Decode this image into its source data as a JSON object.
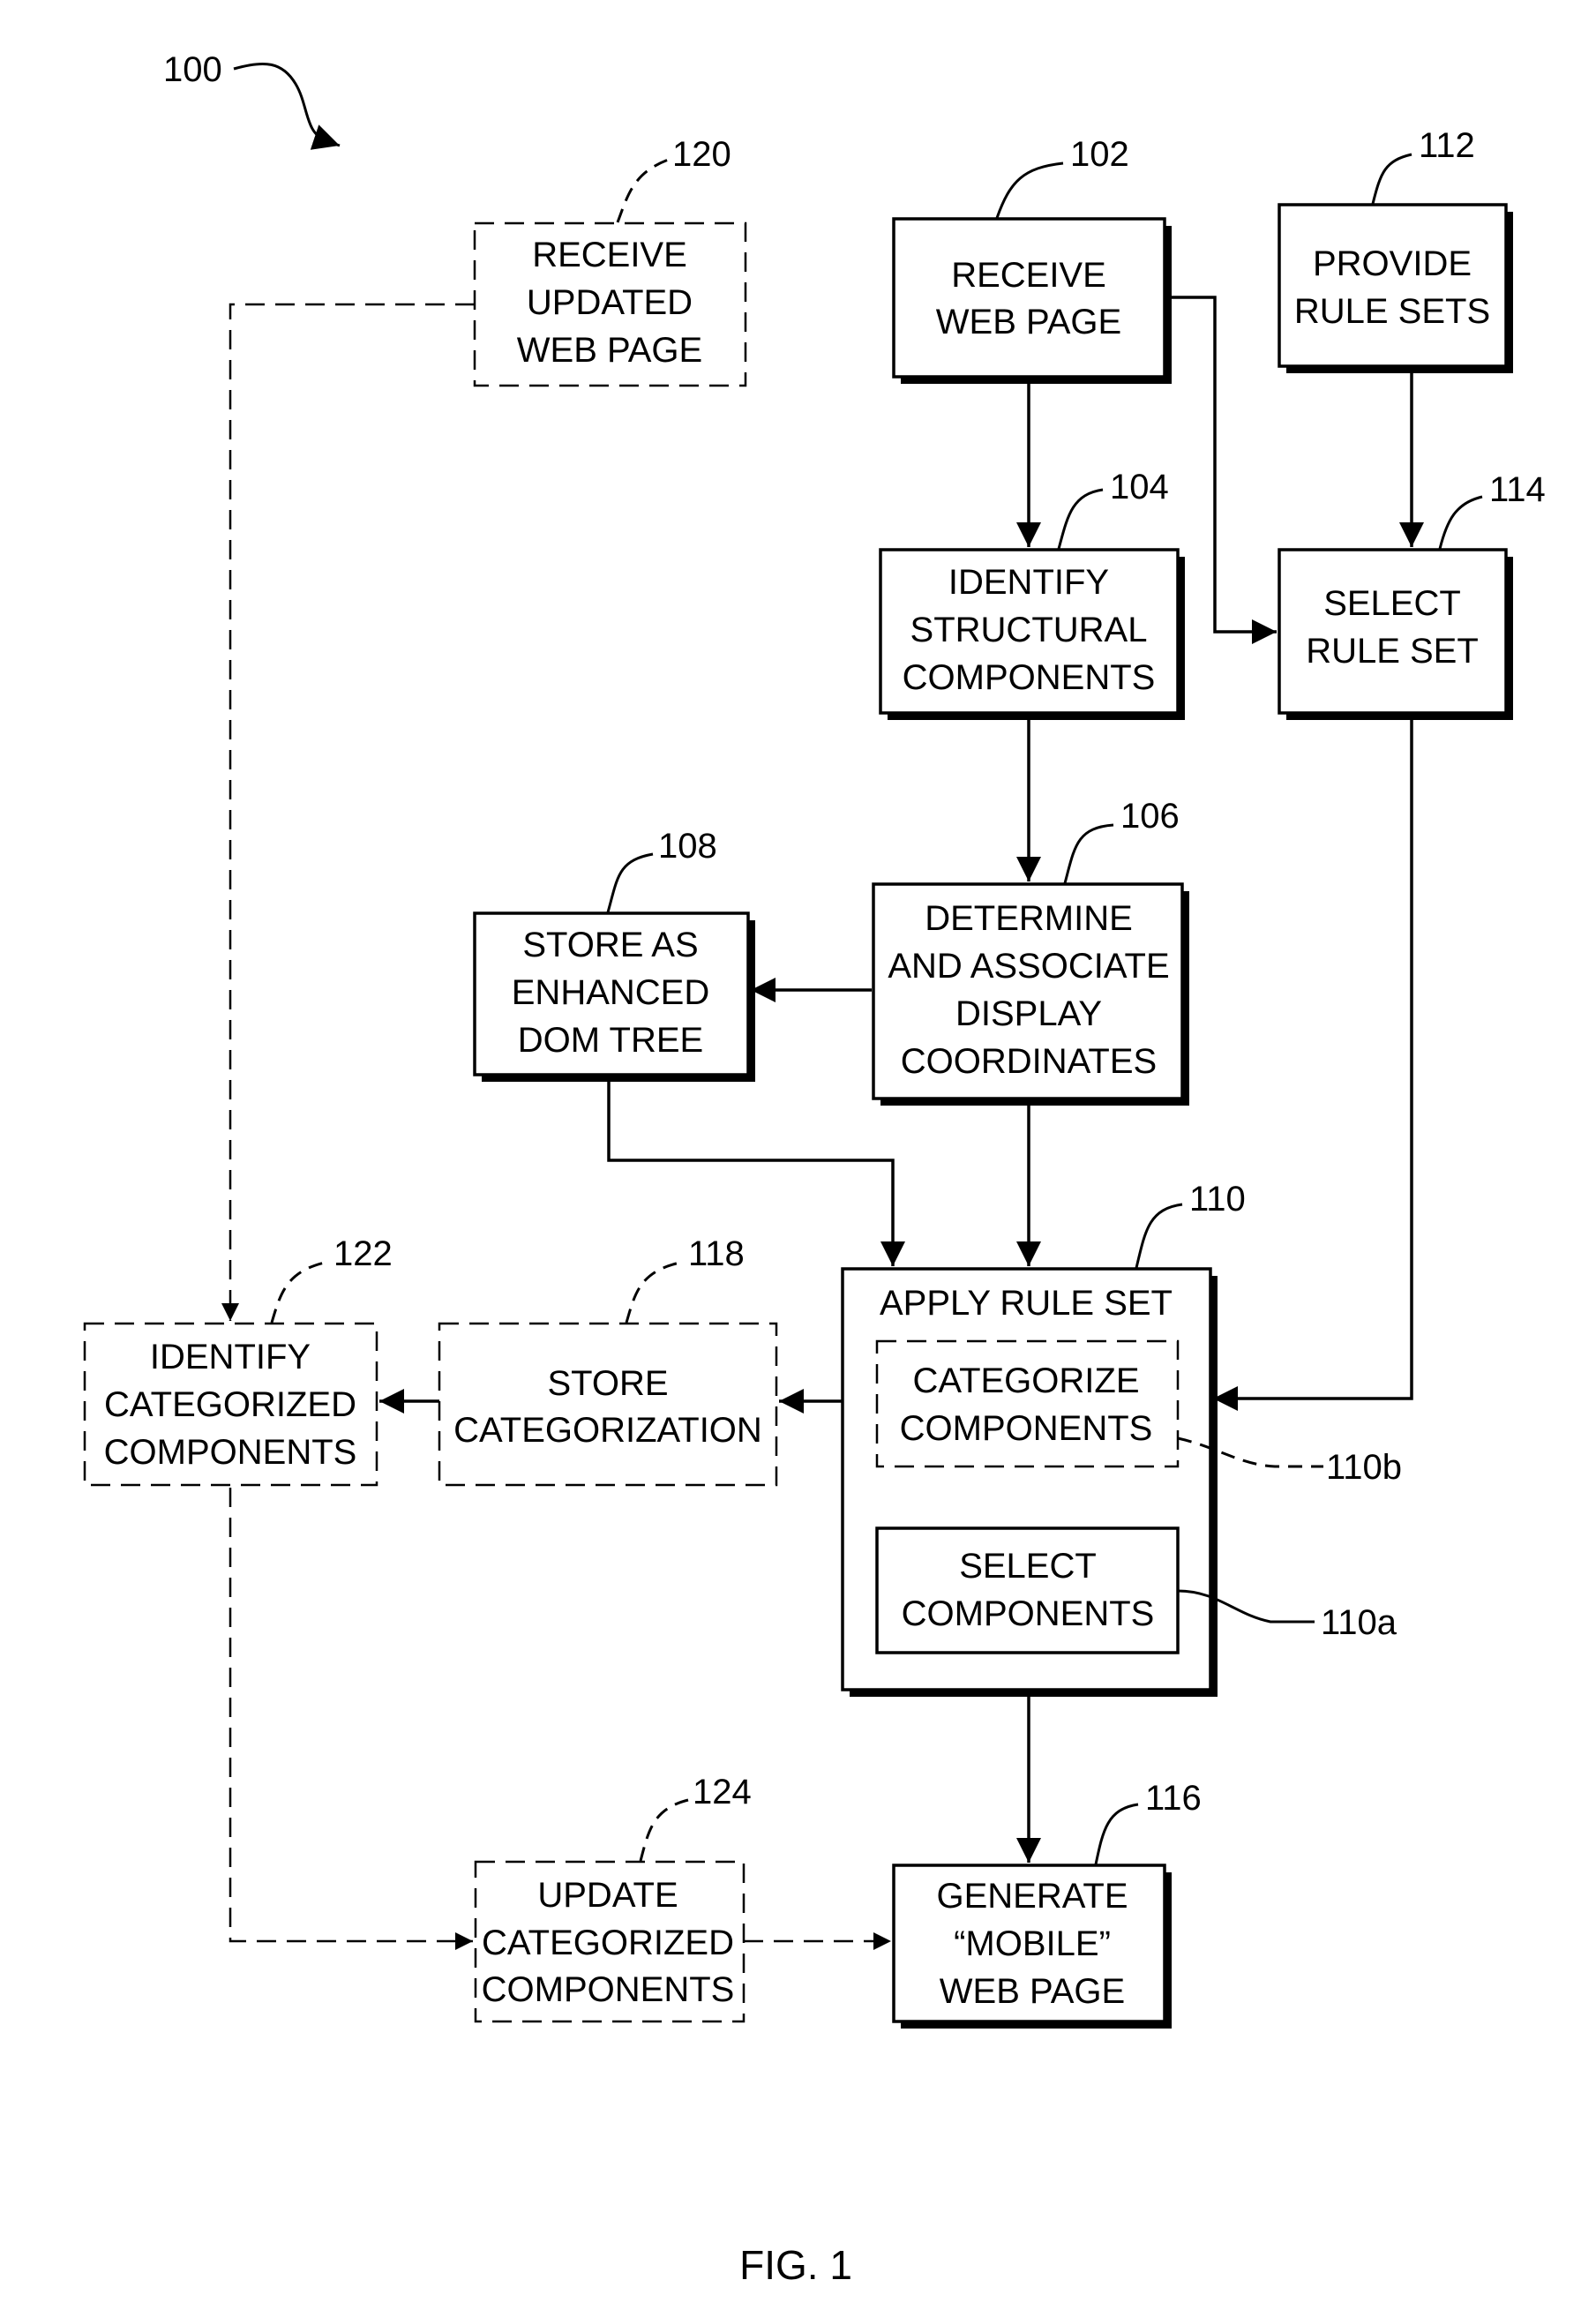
{
  "figure": {
    "caption": "FIG. 1",
    "process_ref": "100"
  },
  "nodes": {
    "n102": {
      "ref": "102",
      "style": "solid",
      "lines": [
        "RECEIVE",
        "WEB PAGE"
      ]
    },
    "n104": {
      "ref": "104",
      "style": "solid",
      "lines": [
        "IDENTIFY",
        "STRUCTURAL",
        "COMPONENTS"
      ]
    },
    "n106": {
      "ref": "106",
      "style": "solid",
      "lines": [
        "DETERMINE",
        "AND ASSOCIATE",
        "DISPLAY",
        "COORDINATES"
      ]
    },
    "n108": {
      "ref": "108",
      "style": "solid",
      "lines": [
        "STORE AS",
        "ENHANCED",
        "DOM TREE"
      ]
    },
    "n110": {
      "ref": "110",
      "style": "solid",
      "lines": [
        "APPLY RULE SET"
      ]
    },
    "n110b": {
      "ref": "110b",
      "style": "dashed",
      "lines": [
        "CATEGORIZE",
        "COMPONENTS"
      ]
    },
    "n110a": {
      "ref": "110a",
      "style": "solid",
      "lines": [
        "SELECT",
        "COMPONENTS"
      ]
    },
    "n112": {
      "ref": "112",
      "style": "solid",
      "lines": [
        "PROVIDE",
        "RULE SETS"
      ]
    },
    "n114": {
      "ref": "114",
      "style": "solid",
      "lines": [
        "SELECT",
        "RULE SET"
      ]
    },
    "n116": {
      "ref": "116",
      "style": "solid",
      "lines": [
        "GENERATE",
        "“MOBILE”",
        "WEB PAGE"
      ]
    },
    "n118": {
      "ref": "118",
      "style": "dashed",
      "lines": [
        "STORE",
        "CATEGORIZATION"
      ]
    },
    "n120": {
      "ref": "120",
      "style": "dashed",
      "lines": [
        "RECEIVE",
        "UPDATED",
        "WEB PAGE"
      ]
    },
    "n122": {
      "ref": "122",
      "style": "dashed",
      "lines": [
        "IDENTIFY",
        "CATEGORIZED",
        "COMPONENTS"
      ]
    },
    "n124": {
      "ref": "124",
      "style": "dashed",
      "lines": [
        "UPDATE",
        "CATEGORIZED",
        "COMPONENTS"
      ]
    }
  },
  "edges": [
    {
      "from": "102",
      "to": "104",
      "style": "solid"
    },
    {
      "from": "102",
      "to": "114",
      "style": "solid"
    },
    {
      "from": "112",
      "to": "114",
      "style": "solid"
    },
    {
      "from": "104",
      "to": "106",
      "style": "solid"
    },
    {
      "from": "106",
      "to": "108",
      "style": "solid"
    },
    {
      "from": "108",
      "to": "110",
      "style": "solid"
    },
    {
      "from": "106",
      "to": "110",
      "style": "solid"
    },
    {
      "from": "114",
      "to": "110",
      "style": "solid"
    },
    {
      "from": "110b",
      "to": "110a",
      "style": "solid"
    },
    {
      "from": "110b",
      "to": "118",
      "style": "solid"
    },
    {
      "from": "118",
      "to": "122",
      "style": "solid"
    },
    {
      "from": "120",
      "to": "122",
      "style": "dashed"
    },
    {
      "from": "122",
      "to": "124",
      "style": "dashed"
    },
    {
      "from": "124",
      "to": "116",
      "style": "dashed"
    },
    {
      "from": "110",
      "to": "116",
      "style": "solid"
    }
  ]
}
